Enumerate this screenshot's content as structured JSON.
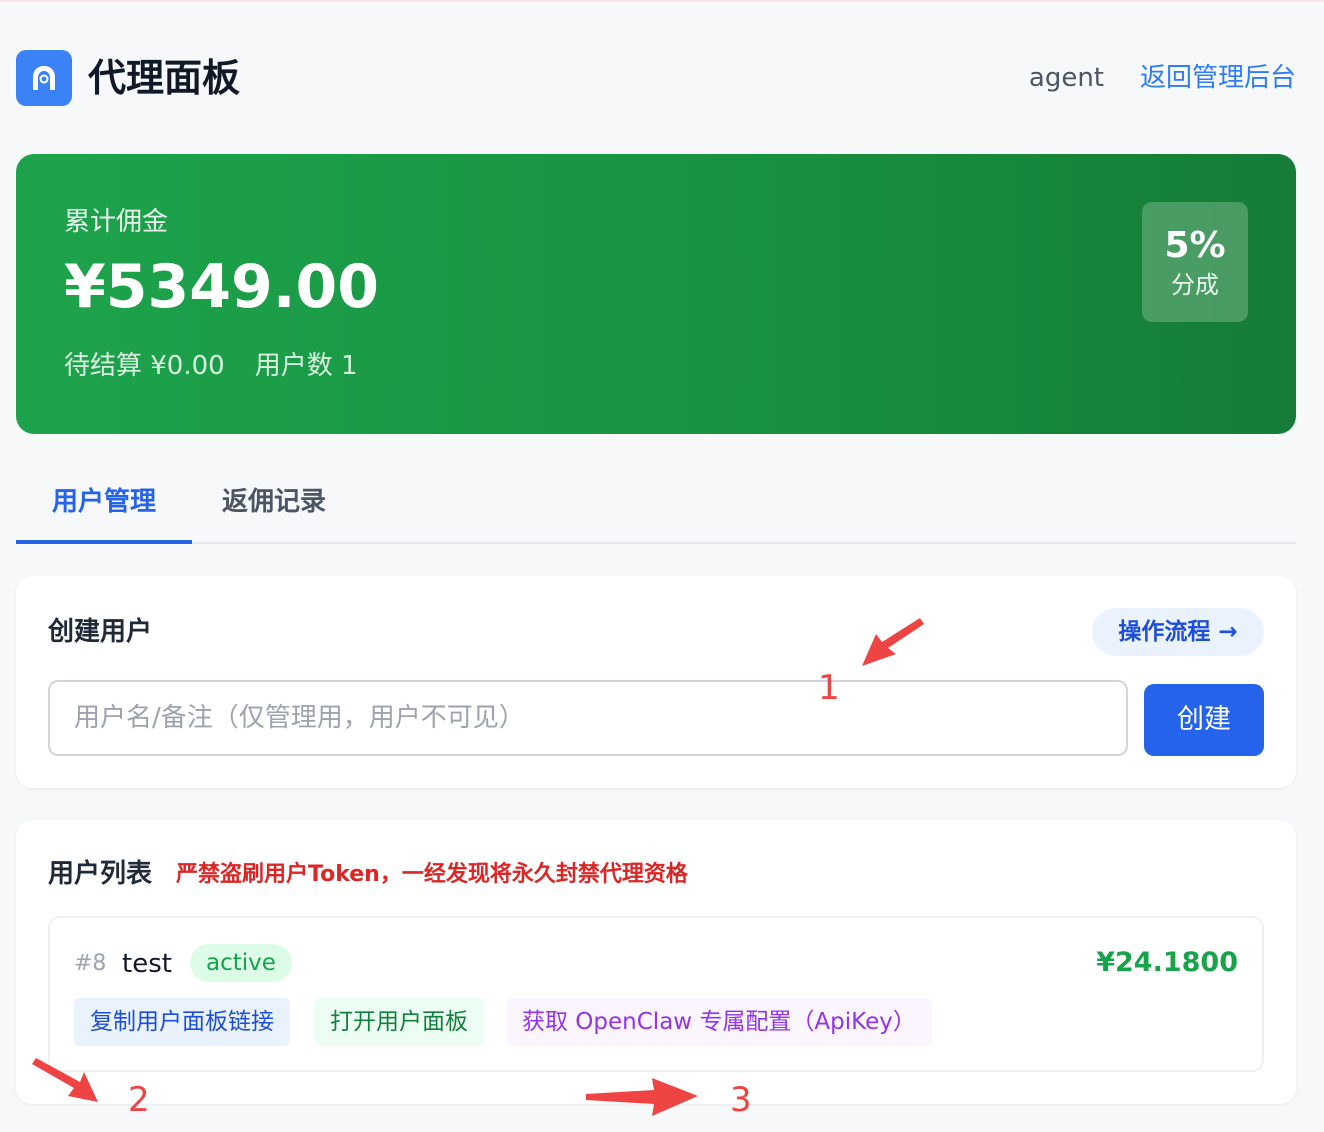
{
  "header": {
    "title": "代理面板",
    "username": "agent",
    "back_link": "返回管理后台"
  },
  "commission": {
    "label": "累计佣金",
    "amount": "¥5349.00",
    "pending": "待结算 ¥0.00",
    "user_count": "用户数 1",
    "rate_value": "5%",
    "rate_label": "分成"
  },
  "tabs": [
    {
      "label": "用户管理",
      "active": true
    },
    {
      "label": "返佣记录",
      "active": false
    }
  ],
  "create_user": {
    "title": "创建用户",
    "flow_button": "操作流程 →",
    "input_placeholder": "用户名/备注（仅管理用，用户不可见）",
    "input_value": "",
    "create_button": "创建"
  },
  "user_list": {
    "title": "用户列表",
    "warning": "严禁盗刷用户Token，一经发现将永久封禁代理资格",
    "users": [
      {
        "id": "#8",
        "name": "test",
        "status": "active",
        "balance": "¥24.1800",
        "actions": {
          "copy_link": "复制用户面板链接",
          "open_panel": "打开用户面板",
          "get_config": "获取 OpenClaw 专属配置（ApiKey）"
        }
      }
    ]
  },
  "annotations": {
    "one": "1",
    "two": "2",
    "three": "3"
  },
  "colors": {
    "accent": "#2563eb",
    "commission_green": "#179140",
    "warning_red": "#dc2626",
    "annotation_red": "#ef4444"
  }
}
